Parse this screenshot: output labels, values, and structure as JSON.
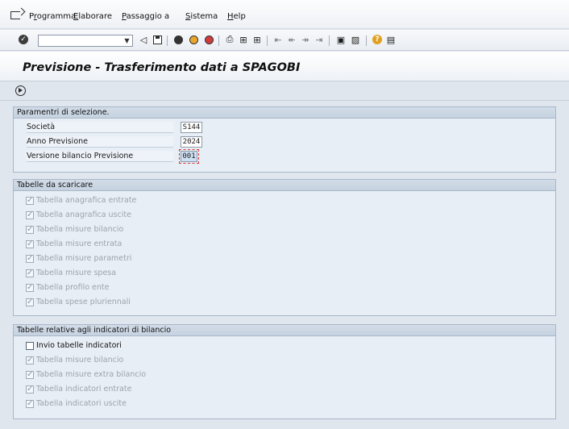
{
  "menubar": {
    "items": [
      {
        "label": "Programma",
        "ul": "r"
      },
      {
        "label": "Elaborare",
        "ul": "E"
      },
      {
        "label": "Passaggio a",
        "ul": "P"
      },
      {
        "label": "Sistema",
        "ul": "S"
      },
      {
        "label": "Help",
        "ul": "H"
      }
    ]
  },
  "toolbar": {
    "command_value": "",
    "icons": [
      "enter-icon",
      "back-icon",
      "save-icon",
      "refresh-icon",
      "exit-icon",
      "cancel-icon",
      "print-icon",
      "find-icon",
      "find-next-icon",
      "first-page-icon",
      "prev-page-icon",
      "next-page-icon",
      "last-page-icon",
      "new-session-icon",
      "shortcut-icon",
      "help-icon",
      "layout-icon"
    ]
  },
  "title": "Previsione - Trasferimento dati a SPAGOBI",
  "sections": {
    "selection": {
      "heading": "Paramentri di selezione.",
      "fields": [
        {
          "label": "Società",
          "value": "S144"
        },
        {
          "label": "Anno Previsione",
          "value": "2024"
        },
        {
          "label": "Versione bilancio Previsione",
          "value": "001"
        }
      ]
    },
    "download": {
      "heading": "Tabelle da scaricare",
      "items": [
        "Tabella anagrafica entrate",
        "Tabella anagrafica uscite",
        "Tabella misure bilancio",
        "Tabella misure entrata",
        "Tabella misure parametri",
        "Tabella misure spesa",
        "Tabella profilo ente",
        "Tabella spese pluriennali"
      ]
    },
    "indicators": {
      "heading": "Tabelle relative agli indicatori di bilancio",
      "send_label": "Invio tabelle indicatori",
      "items": [
        "Tabella misure bilancio",
        "Tabella misure extra bilancio",
        "Tabella indicatori entrate",
        "Tabella indicatori uscite"
      ]
    }
  }
}
